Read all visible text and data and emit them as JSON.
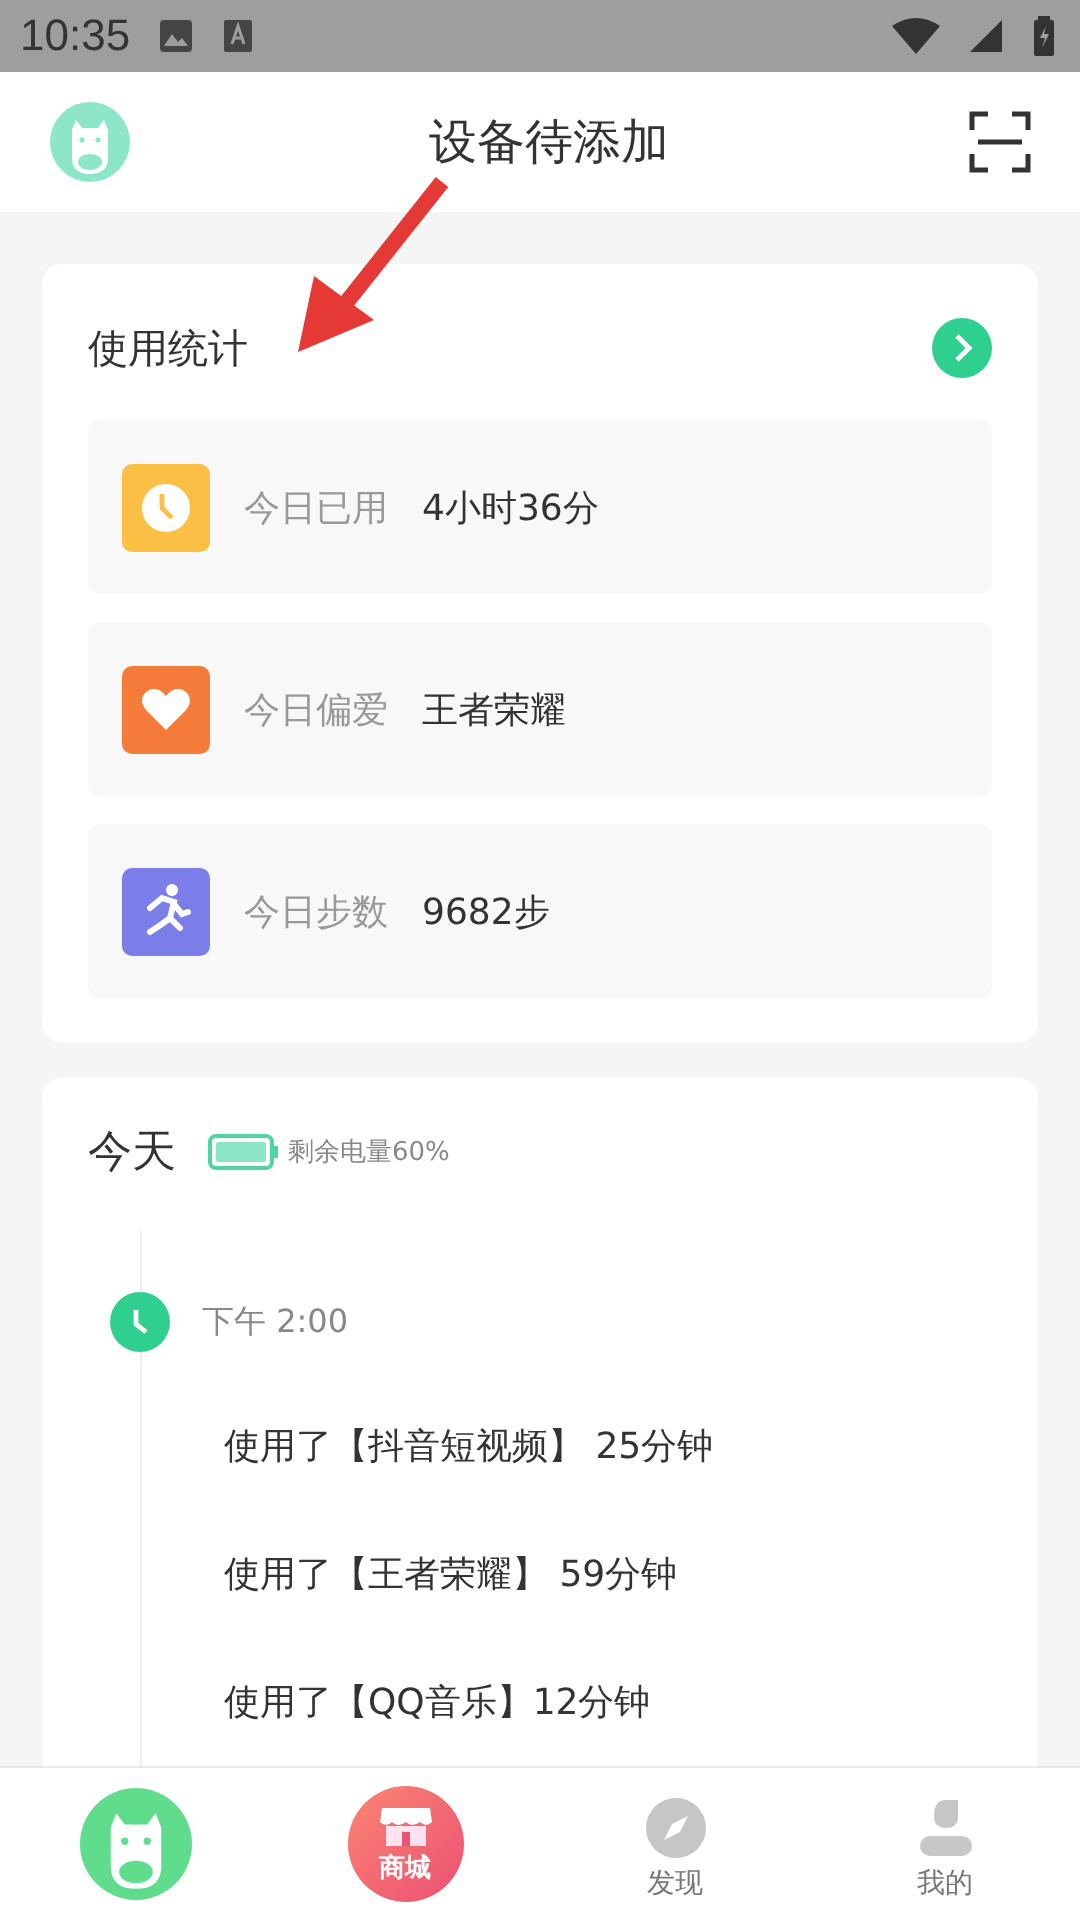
{
  "status_bar": {
    "time": "10:35"
  },
  "header": {
    "title": "设备待添加"
  },
  "usage_card": {
    "title": "使用统计",
    "items": [
      {
        "kind": "clock",
        "label": "今日已用",
        "value": "4小时36分",
        "color": "#fbbf45"
      },
      {
        "kind": "heart",
        "label": "今日偏爱",
        "value": "王者荣耀",
        "color": "#f57b3a"
      },
      {
        "kind": "run",
        "label": "今日步数",
        "value": "9682步",
        "color": "#7b7ee8"
      }
    ]
  },
  "today_card": {
    "title": "今天",
    "battery_text": "剩余电量60%",
    "timeline": [
      {
        "time": "下午 2:00",
        "entries": [
          "使用了【抖音短视频】 25分钟",
          "使用了【王者荣耀】 59分钟",
          "使用了【QQ音乐】12分钟"
        ]
      }
    ]
  },
  "bottom_nav": [
    {
      "kind": "home",
      "selected": true
    },
    {
      "kind": "shop",
      "label": "商城",
      "selected": false
    },
    {
      "kind": "discover",
      "label": "发现",
      "selected": false
    },
    {
      "kind": "profile",
      "label": "我的",
      "selected": false
    }
  ]
}
